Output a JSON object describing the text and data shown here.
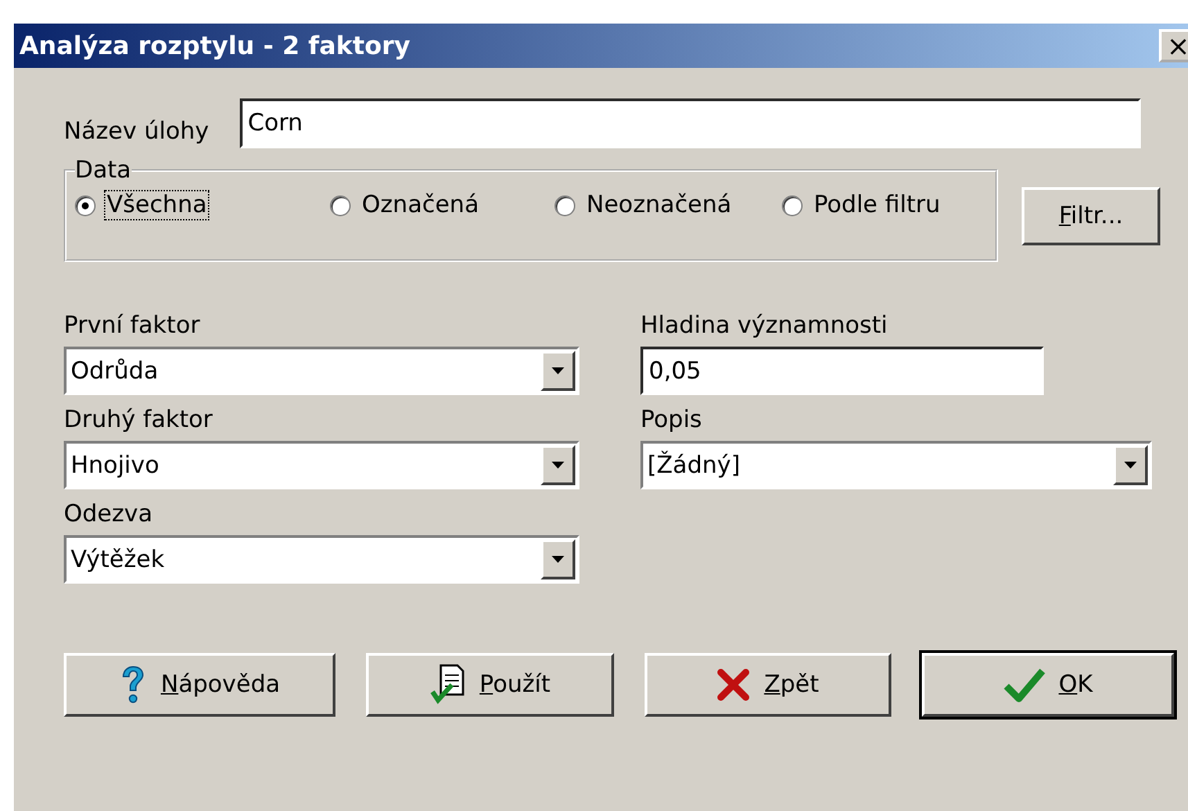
{
  "window": {
    "title": "Analýza rozptylu - 2 faktory",
    "close": "×"
  },
  "task_name": {
    "label": "Název úlohy",
    "value": "Corn"
  },
  "data_group": {
    "label": "Data",
    "options": [
      {
        "label": "Všechna",
        "selected": true
      },
      {
        "label": "Označená",
        "selected": false
      },
      {
        "label": "Neoznačená",
        "selected": false
      },
      {
        "label": "Podle filtru",
        "selected": false
      }
    ],
    "filter_button": "Filtr..."
  },
  "left_fields": [
    {
      "label": "První faktor",
      "value": "Odrůda"
    },
    {
      "label": "Druhý faktor",
      "value": "Hnojivo"
    },
    {
      "label": "Odezva",
      "value": "Výtěžek"
    }
  ],
  "right_fields": [
    {
      "kind": "input",
      "label": "Hladina významnosti",
      "value": "0,05"
    },
    {
      "kind": "combo",
      "label": "Popis",
      "value": "[Žádný]"
    }
  ],
  "buttons": [
    {
      "kind": "help",
      "label": "Nápověda",
      "default": false
    },
    {
      "kind": "apply",
      "label": "Použít",
      "default": false
    },
    {
      "kind": "back",
      "label": "Zpět",
      "default": false
    },
    {
      "kind": "ok",
      "label": "OK",
      "default": true
    }
  ]
}
